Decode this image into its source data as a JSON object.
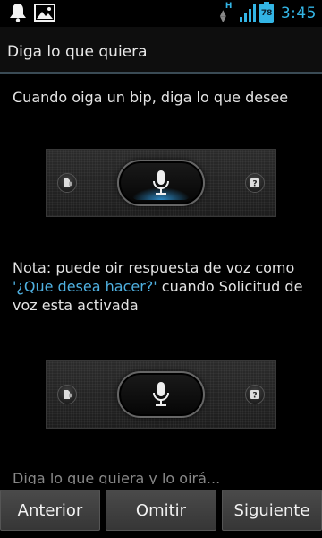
{
  "status_bar": {
    "network_type": "H",
    "battery_level": "78",
    "time": "3:45",
    "accent_color": "#33b5e5",
    "left_icons": [
      "notification-bell-icon",
      "image-gallery-icon"
    ]
  },
  "header": {
    "title": "Diga lo que quiera"
  },
  "main": {
    "instruction": "Cuando oiga un bip, diga lo que desee",
    "note_prefix": "Nota: puede oir respuesta de voz como ",
    "note_link": "'¿Que desea hacer?'",
    "note_suffix": " cuando Solicitud de voz esta activada",
    "link_color": "#4fb0e0",
    "faded_text": "Diga lo que quiera y lo oirá..."
  },
  "footer": {
    "prev_label": "Anterior",
    "skip_label": "Omitir",
    "next_label": "Siguiente"
  }
}
